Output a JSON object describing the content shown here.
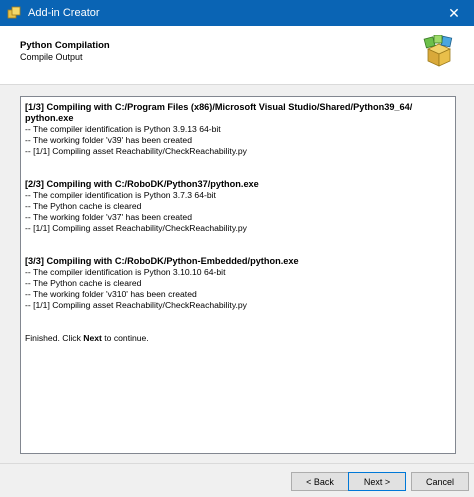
{
  "window": {
    "title": "Add-in Creator",
    "close_glyph": "✕"
  },
  "header": {
    "title": "Python Compilation",
    "subtitle": "Compile Output",
    "icon": "package-icon"
  },
  "log": {
    "step1": {
      "title_a": "[1/3] Compiling with C:/Program Files (x86)/Microsoft Visual Studio/Shared/Python39_64/",
      "title_b": "python.exe",
      "lines": [
        "-- The compiler identification is Python 3.9.13 64-bit",
        "-- The working folder 'v39' has been created",
        "-- [1/1] Compiling asset Reachability/CheckReachability.py"
      ]
    },
    "step2": {
      "title": "[2/3] Compiling with C:/RoboDK/Python37/python.exe",
      "lines": [
        "-- The compiler identification is Python 3.7.3 64-bit",
        "-- The Python cache is cleared",
        "-- The working folder 'v37' has been created",
        "-- [1/1] Compiling asset Reachability/CheckReachability.py"
      ]
    },
    "step3": {
      "title": "[3/3] Compiling with C:/RoboDK/Python-Embedded/python.exe",
      "lines": [
        "-- The compiler identification is Python 3.10.10 64-bit",
        "-- The Python cache is cleared",
        "-- The working folder 'v310' has been created",
        "-- [1/1] Compiling asset Reachability/CheckReachability.py"
      ]
    },
    "finished": {
      "before": "Finished. Click ",
      "bold": "Next",
      "after": " to continue."
    }
  },
  "buttons": {
    "back": "< Back",
    "next": "Next >",
    "cancel": "Cancel"
  },
  "colors": {
    "titlebar": "#0a64b4",
    "dialog_bg": "#f0f0f0",
    "focus_border": "#0078d7"
  }
}
